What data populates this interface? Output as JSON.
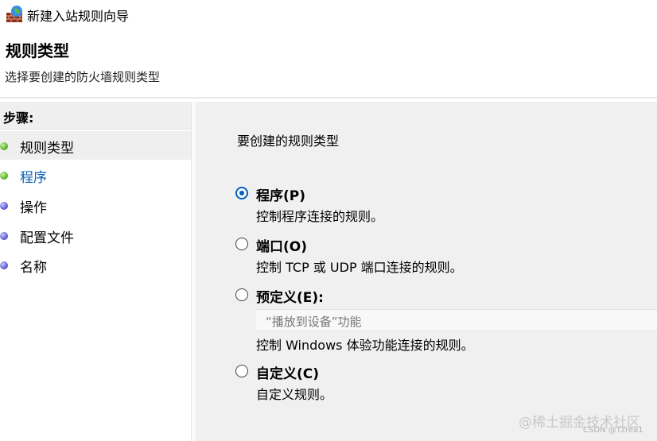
{
  "window": {
    "title": "新建入站规则向导",
    "icon": "firewall-wizard-icon"
  },
  "header": {
    "title": "规则类型",
    "subtitle": "选择要创建的防火墙规则类型"
  },
  "steps": {
    "heading": "步骤:",
    "items": [
      {
        "label": "规则类型",
        "bullet": "green",
        "state": "current"
      },
      {
        "label": "程序",
        "bullet": "green",
        "state": "link"
      },
      {
        "label": "操作",
        "bullet": "blue",
        "state": "normal"
      },
      {
        "label": "配置文件",
        "bullet": "blue",
        "state": "normal"
      },
      {
        "label": "名称",
        "bullet": "blue",
        "state": "normal"
      }
    ]
  },
  "main": {
    "question": "要创建的规则类型",
    "options": [
      {
        "label": "程序(P)",
        "description": "控制程序连接的规则。",
        "checked": true
      },
      {
        "label": "端口(O)",
        "description": "控制 TCP 或 UDP 端口连接的规则。",
        "checked": false
      },
      {
        "label": "预定义(E):",
        "description": "控制 Windows 体验功能连接的规则。",
        "checked": false,
        "selected_value": "“播放到设备”功能"
      },
      {
        "label": "自定义(C)",
        "description": "自定义规则。",
        "checked": false
      }
    ]
  },
  "watermark": {
    "text": "@稀土掘金技术社区",
    "sub": "CSDN @Tzrea1"
  },
  "colors": {
    "accent": "#0060c0",
    "link": "#0a5fb4",
    "content_bg": "#f0f0f0"
  }
}
